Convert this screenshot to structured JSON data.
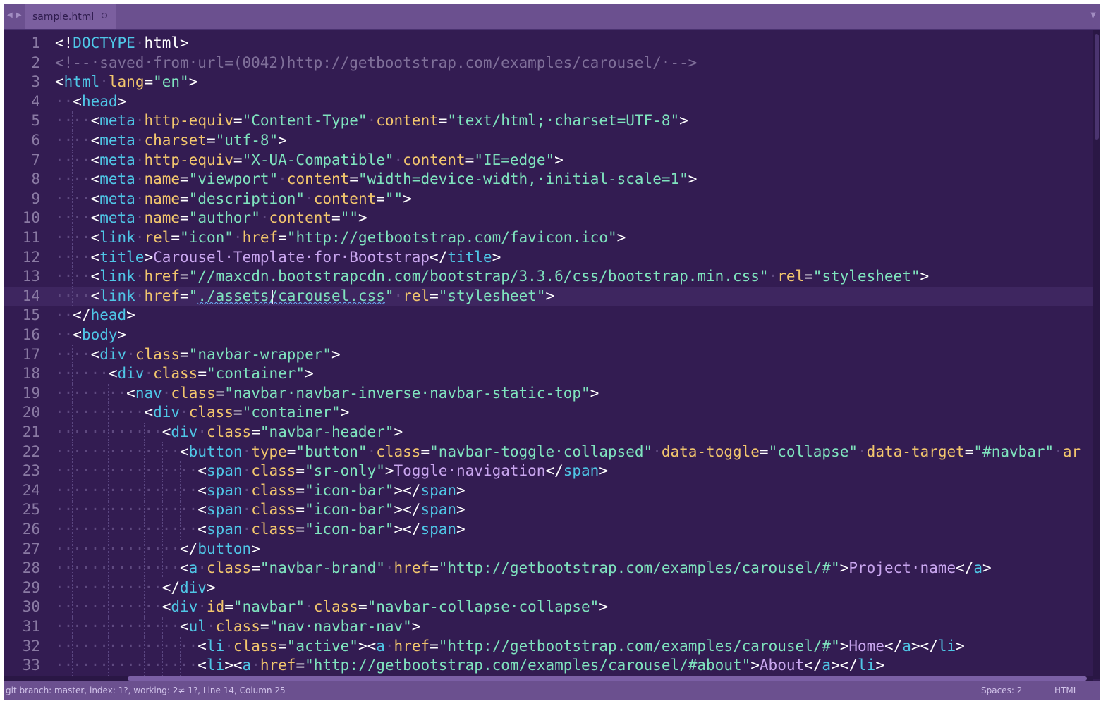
{
  "tab": {
    "filename": "sample.html"
  },
  "status": {
    "left": "git branch: master, index: 1?, working: 2≠ 1?, Line 14, Column 25",
    "spaces": "Spaces: 2",
    "syntax": "HTML"
  },
  "colors": {
    "background": "#331c52",
    "tab_bar": "#6b508f",
    "tag": "#4fc6e6",
    "attribute": "#f2c66d",
    "string": "#7fe3be",
    "comment": "#7f6f99",
    "text": "#c9a6ef"
  },
  "cursor": {
    "line": 14,
    "column": 25
  },
  "lines": [
    {
      "n": "1",
      "d": 0,
      "toks": [
        [
          "p",
          "<!"
        ],
        [
          "tg",
          "DOCTYPE"
        ],
        [
          "ws",
          "·"
        ],
        [
          "p",
          "html>"
        ]
      ]
    },
    {
      "n": "2",
      "d": 0,
      "toks": [
        [
          "cm",
          "<!--·saved·from·url=(0042)http://getbootstrap.com/examples/carousel/·-->"
        ]
      ]
    },
    {
      "n": "3",
      "d": 0,
      "toks": [
        [
          "p",
          "<"
        ],
        [
          "tg",
          "html"
        ],
        [
          "ws",
          "·"
        ],
        [
          "at",
          "lang"
        ],
        [
          "p",
          "="
        ],
        [
          "st",
          "\"en\""
        ],
        [
          "p",
          ">"
        ]
      ]
    },
    {
      "n": "4",
      "d": 1,
      "toks": [
        [
          "p",
          "<"
        ],
        [
          "tg",
          "head"
        ],
        [
          "p",
          ">"
        ]
      ]
    },
    {
      "n": "5",
      "d": 2,
      "toks": [
        [
          "p",
          "<"
        ],
        [
          "tg",
          "meta"
        ],
        [
          "ws",
          "·"
        ],
        [
          "at",
          "http-equiv"
        ],
        [
          "p",
          "="
        ],
        [
          "st",
          "\"Content-Type\""
        ],
        [
          "ws",
          "·"
        ],
        [
          "at",
          "content"
        ],
        [
          "p",
          "="
        ],
        [
          "st",
          "\"text/html;·charset=UTF-8\""
        ],
        [
          "p",
          ">"
        ]
      ]
    },
    {
      "n": "6",
      "d": 2,
      "toks": [
        [
          "p",
          "<"
        ],
        [
          "tg",
          "meta"
        ],
        [
          "ws",
          "·"
        ],
        [
          "at",
          "charset"
        ],
        [
          "p",
          "="
        ],
        [
          "st",
          "\"utf-8\""
        ],
        [
          "p",
          ">"
        ]
      ]
    },
    {
      "n": "7",
      "d": 2,
      "toks": [
        [
          "p",
          "<"
        ],
        [
          "tg",
          "meta"
        ],
        [
          "ws",
          "·"
        ],
        [
          "at",
          "http-equiv"
        ],
        [
          "p",
          "="
        ],
        [
          "st",
          "\"X-UA-Compatible\""
        ],
        [
          "ws",
          "·"
        ],
        [
          "at",
          "content"
        ],
        [
          "p",
          "="
        ],
        [
          "st",
          "\"IE=edge\""
        ],
        [
          "p",
          ">"
        ]
      ]
    },
    {
      "n": "8",
      "d": 2,
      "toks": [
        [
          "p",
          "<"
        ],
        [
          "tg",
          "meta"
        ],
        [
          "ws",
          "·"
        ],
        [
          "at",
          "name"
        ],
        [
          "p",
          "="
        ],
        [
          "st",
          "\"viewport\""
        ],
        [
          "ws",
          "·"
        ],
        [
          "at",
          "content"
        ],
        [
          "p",
          "="
        ],
        [
          "st",
          "\"width=device-width,·initial-scale=1\""
        ],
        [
          "p",
          ">"
        ]
      ]
    },
    {
      "n": "9",
      "d": 2,
      "toks": [
        [
          "p",
          "<"
        ],
        [
          "tg",
          "meta"
        ],
        [
          "ws",
          "·"
        ],
        [
          "at",
          "name"
        ],
        [
          "p",
          "="
        ],
        [
          "st",
          "\"description\""
        ],
        [
          "ws",
          "·"
        ],
        [
          "at",
          "content"
        ],
        [
          "p",
          "="
        ],
        [
          "st",
          "\"\""
        ],
        [
          "p",
          ">"
        ]
      ]
    },
    {
      "n": "10",
      "d": 2,
      "toks": [
        [
          "p",
          "<"
        ],
        [
          "tg",
          "meta"
        ],
        [
          "ws",
          "·"
        ],
        [
          "at",
          "name"
        ],
        [
          "p",
          "="
        ],
        [
          "st",
          "\"author\""
        ],
        [
          "ws",
          "·"
        ],
        [
          "at",
          "content"
        ],
        [
          "p",
          "="
        ],
        [
          "st",
          "\"\""
        ],
        [
          "p",
          ">"
        ]
      ]
    },
    {
      "n": "11",
      "d": 2,
      "toks": [
        [
          "p",
          "<"
        ],
        [
          "tg",
          "link"
        ],
        [
          "ws",
          "·"
        ],
        [
          "at",
          "rel"
        ],
        [
          "p",
          "="
        ],
        [
          "st",
          "\"icon\""
        ],
        [
          "ws",
          "·"
        ],
        [
          "at",
          "href"
        ],
        [
          "p",
          "="
        ],
        [
          "st",
          "\"http://getbootstrap.com/favicon.ico\""
        ],
        [
          "p",
          ">"
        ]
      ]
    },
    {
      "n": "12",
      "d": 2,
      "toks": [
        [
          "p",
          "<"
        ],
        [
          "tg",
          "title"
        ],
        [
          "p",
          ">"
        ],
        [
          "tx",
          "Carousel·Template·for·Bootstrap"
        ],
        [
          "p",
          "</"
        ],
        [
          "tg",
          "title"
        ],
        [
          "p",
          ">"
        ]
      ]
    },
    {
      "n": "13",
      "d": 2,
      "toks": [
        [
          "p",
          "<"
        ],
        [
          "tg",
          "link"
        ],
        [
          "ws",
          "·"
        ],
        [
          "at",
          "href"
        ],
        [
          "p",
          "="
        ],
        [
          "st",
          "\"//maxcdn.bootstrapcdn.com/bootstrap/3.3.6/css/bootstrap.min.css\""
        ],
        [
          "ws",
          "·"
        ],
        [
          "at",
          "rel"
        ],
        [
          "p",
          "="
        ],
        [
          "st",
          "\"stylesheet\""
        ],
        [
          "p",
          ">"
        ]
      ]
    },
    {
      "n": "14",
      "d": 2,
      "current": true,
      "toks": [
        [
          "p",
          "<"
        ],
        [
          "tg",
          "link"
        ],
        [
          "ws",
          "·"
        ],
        [
          "at",
          "href"
        ],
        [
          "p",
          "="
        ],
        [
          "st",
          "\""
        ],
        [
          "sq",
          "./assets/carousel.css"
        ],
        [
          "st",
          "\""
        ],
        [
          "ws",
          "·"
        ],
        [
          "at",
          "rel"
        ],
        [
          "p",
          "="
        ],
        [
          "st",
          "\"stylesheet\""
        ],
        [
          "p",
          ">"
        ]
      ]
    },
    {
      "n": "15",
      "d": 1,
      "toks": [
        [
          "p",
          "</"
        ],
        [
          "tg",
          "head"
        ],
        [
          "p",
          ">"
        ]
      ]
    },
    {
      "n": "16",
      "d": 1,
      "toks": [
        [
          "p",
          "<"
        ],
        [
          "tg",
          "body"
        ],
        [
          "p",
          ">"
        ]
      ]
    },
    {
      "n": "17",
      "d": 2,
      "toks": [
        [
          "p",
          "<"
        ],
        [
          "tg",
          "div"
        ],
        [
          "ws",
          "·"
        ],
        [
          "at",
          "class"
        ],
        [
          "p",
          "="
        ],
        [
          "st",
          "\"navbar-wrapper\""
        ],
        [
          "p",
          ">"
        ]
      ]
    },
    {
      "n": "18",
      "d": 3,
      "toks": [
        [
          "p",
          "<"
        ],
        [
          "tg",
          "div"
        ],
        [
          "ws",
          "·"
        ],
        [
          "at",
          "class"
        ],
        [
          "p",
          "="
        ],
        [
          "st",
          "\"container\""
        ],
        [
          "p",
          ">"
        ]
      ]
    },
    {
      "n": "19",
      "d": 4,
      "toks": [
        [
          "p",
          "<"
        ],
        [
          "tg",
          "nav"
        ],
        [
          "ws",
          "·"
        ],
        [
          "at",
          "class"
        ],
        [
          "p",
          "="
        ],
        [
          "st",
          "\"navbar·navbar-inverse·navbar-static-top\""
        ],
        [
          "p",
          ">"
        ]
      ]
    },
    {
      "n": "20",
      "d": 5,
      "toks": [
        [
          "p",
          "<"
        ],
        [
          "tg",
          "div"
        ],
        [
          "ws",
          "·"
        ],
        [
          "at",
          "class"
        ],
        [
          "p",
          "="
        ],
        [
          "st",
          "\"container\""
        ],
        [
          "p",
          ">"
        ]
      ]
    },
    {
      "n": "21",
      "d": 6,
      "toks": [
        [
          "p",
          "<"
        ],
        [
          "tg",
          "div"
        ],
        [
          "ws",
          "·"
        ],
        [
          "at",
          "class"
        ],
        [
          "p",
          "="
        ],
        [
          "st",
          "\"navbar-header\""
        ],
        [
          "p",
          ">"
        ]
      ]
    },
    {
      "n": "22",
      "d": 7,
      "toks": [
        [
          "p",
          "<"
        ],
        [
          "tg",
          "button"
        ],
        [
          "ws",
          "·"
        ],
        [
          "at",
          "type"
        ],
        [
          "p",
          "="
        ],
        [
          "st",
          "\"button\""
        ],
        [
          "ws",
          "·"
        ],
        [
          "at",
          "class"
        ],
        [
          "p",
          "="
        ],
        [
          "st",
          "\"navbar-toggle·collapsed\""
        ],
        [
          "ws",
          "·"
        ],
        [
          "at",
          "data-toggle"
        ],
        [
          "p",
          "="
        ],
        [
          "st",
          "\"collapse\""
        ],
        [
          "ws",
          "·"
        ],
        [
          "at",
          "data-target"
        ],
        [
          "p",
          "="
        ],
        [
          "st",
          "\"#navbar\""
        ],
        [
          "ws",
          "·"
        ],
        [
          "at",
          "ar"
        ]
      ]
    },
    {
      "n": "23",
      "d": 8,
      "toks": [
        [
          "p",
          "<"
        ],
        [
          "tg",
          "span"
        ],
        [
          "ws",
          "·"
        ],
        [
          "at",
          "class"
        ],
        [
          "p",
          "="
        ],
        [
          "st",
          "\"sr-only\""
        ],
        [
          "p",
          ">"
        ],
        [
          "tx",
          "Toggle·navigation"
        ],
        [
          "p",
          "</"
        ],
        [
          "tg",
          "span"
        ],
        [
          "p",
          ">"
        ]
      ]
    },
    {
      "n": "24",
      "d": 8,
      "toks": [
        [
          "p",
          "<"
        ],
        [
          "tg",
          "span"
        ],
        [
          "ws",
          "·"
        ],
        [
          "at",
          "class"
        ],
        [
          "p",
          "="
        ],
        [
          "st",
          "\"icon-bar\""
        ],
        [
          "p",
          "></"
        ],
        [
          "tg",
          "span"
        ],
        [
          "p",
          ">"
        ]
      ]
    },
    {
      "n": "25",
      "d": 8,
      "toks": [
        [
          "p",
          "<"
        ],
        [
          "tg",
          "span"
        ],
        [
          "ws",
          "·"
        ],
        [
          "at",
          "class"
        ],
        [
          "p",
          "="
        ],
        [
          "st",
          "\"icon-bar\""
        ],
        [
          "p",
          "></"
        ],
        [
          "tg",
          "span"
        ],
        [
          "p",
          ">"
        ]
      ]
    },
    {
      "n": "26",
      "d": 8,
      "toks": [
        [
          "p",
          "<"
        ],
        [
          "tg",
          "span"
        ],
        [
          "ws",
          "·"
        ],
        [
          "at",
          "class"
        ],
        [
          "p",
          "="
        ],
        [
          "st",
          "\"icon-bar\""
        ],
        [
          "p",
          "></"
        ],
        [
          "tg",
          "span"
        ],
        [
          "p",
          ">"
        ]
      ]
    },
    {
      "n": "27",
      "d": 7,
      "toks": [
        [
          "p",
          "</"
        ],
        [
          "tg",
          "button"
        ],
        [
          "p",
          ">"
        ]
      ]
    },
    {
      "n": "28",
      "d": 7,
      "toks": [
        [
          "p",
          "<"
        ],
        [
          "tg",
          "a"
        ],
        [
          "ws",
          "·"
        ],
        [
          "at",
          "class"
        ],
        [
          "p",
          "="
        ],
        [
          "st",
          "\"navbar-brand\""
        ],
        [
          "ws",
          "·"
        ],
        [
          "at",
          "href"
        ],
        [
          "p",
          "="
        ],
        [
          "st",
          "\"http://getbootstrap.com/examples/carousel/#\""
        ],
        [
          "p",
          ">"
        ],
        [
          "tx",
          "Project·name"
        ],
        [
          "p",
          "</"
        ],
        [
          "tg",
          "a"
        ],
        [
          "p",
          ">"
        ]
      ]
    },
    {
      "n": "29",
      "d": 6,
      "toks": [
        [
          "p",
          "</"
        ],
        [
          "tg",
          "div"
        ],
        [
          "p",
          ">"
        ]
      ]
    },
    {
      "n": "30",
      "d": 6,
      "toks": [
        [
          "p",
          "<"
        ],
        [
          "tg",
          "div"
        ],
        [
          "ws",
          "·"
        ],
        [
          "at",
          "id"
        ],
        [
          "p",
          "="
        ],
        [
          "st",
          "\"navbar\""
        ],
        [
          "ws",
          "·"
        ],
        [
          "at",
          "class"
        ],
        [
          "p",
          "="
        ],
        [
          "st",
          "\"navbar-collapse·collapse\""
        ],
        [
          "p",
          ">"
        ]
      ]
    },
    {
      "n": "31",
      "d": 7,
      "toks": [
        [
          "p",
          "<"
        ],
        [
          "tg",
          "ul"
        ],
        [
          "ws",
          "·"
        ],
        [
          "at",
          "class"
        ],
        [
          "p",
          "="
        ],
        [
          "st",
          "\"nav·navbar-nav\""
        ],
        [
          "p",
          ">"
        ]
      ]
    },
    {
      "n": "32",
      "d": 8,
      "toks": [
        [
          "p",
          "<"
        ],
        [
          "tg",
          "li"
        ],
        [
          "ws",
          "·"
        ],
        [
          "at",
          "class"
        ],
        [
          "p",
          "="
        ],
        [
          "st",
          "\"active\""
        ],
        [
          "p",
          "><"
        ],
        [
          "tg",
          "a"
        ],
        [
          "ws",
          "·"
        ],
        [
          "at",
          "href"
        ],
        [
          "p",
          "="
        ],
        [
          "st",
          "\"http://getbootstrap.com/examples/carousel/#\""
        ],
        [
          "p",
          ">"
        ],
        [
          "tx",
          "Home"
        ],
        [
          "p",
          "</"
        ],
        [
          "tg",
          "a"
        ],
        [
          "p",
          "></"
        ],
        [
          "tg",
          "li"
        ],
        [
          "p",
          ">"
        ]
      ]
    },
    {
      "n": "33",
      "d": 8,
      "toks": [
        [
          "p",
          "<"
        ],
        [
          "tg",
          "li"
        ],
        [
          "p",
          "><"
        ],
        [
          "tg",
          "a"
        ],
        [
          "ws",
          "·"
        ],
        [
          "at",
          "href"
        ],
        [
          "p",
          "="
        ],
        [
          "st",
          "\"http://getbootstrap.com/examples/carousel/#about\""
        ],
        [
          "p",
          ">"
        ],
        [
          "tx",
          "About"
        ],
        [
          "p",
          "</"
        ],
        [
          "tg",
          "a"
        ],
        [
          "p",
          "></"
        ],
        [
          "tg",
          "li"
        ],
        [
          "p",
          ">"
        ]
      ]
    }
  ]
}
